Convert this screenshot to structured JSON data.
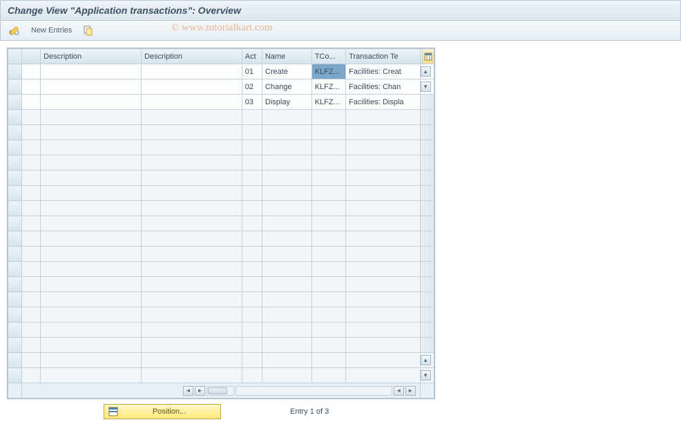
{
  "title": "Change View \"Application transactions\": Overview",
  "watermark": "© www.tutorialkart.com",
  "toolbar": {
    "new_entries_label": "New Entries"
  },
  "columns": {
    "desc1": "Description",
    "desc2": "Description",
    "act": "Act",
    "name": "Name",
    "tcode": "TCo...",
    "ttext": "Transaction Te"
  },
  "rows": [
    {
      "desc1": "",
      "desc2": "",
      "act": "01",
      "name": "Create",
      "tcode": "KLFZ...",
      "ttext": "Facilities: Creat"
    },
    {
      "desc1": "",
      "desc2": "",
      "act": "02",
      "name": "Change",
      "tcode": "KLFZ...",
      "ttext": "Facilities: Chan"
    },
    {
      "desc1": "",
      "desc2": "",
      "act": "03",
      "name": "Display",
      "tcode": "KLFZ...",
      "ttext": "Facilities: Displa"
    }
  ],
  "footer": {
    "position_label": "Position...",
    "entry_label": "Entry 1 of 3"
  }
}
